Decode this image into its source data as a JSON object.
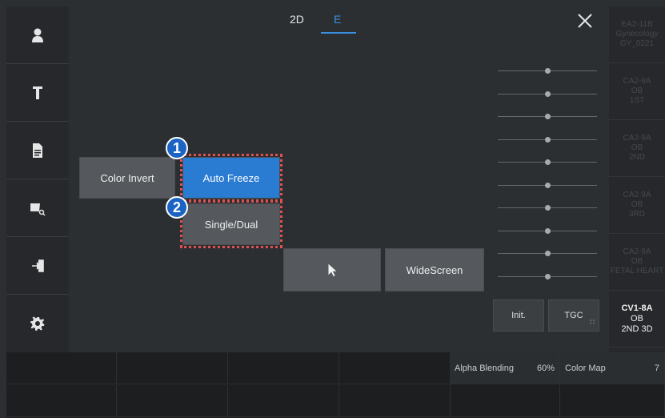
{
  "tabs": [
    {
      "label": "2D"
    },
    {
      "label": "E"
    }
  ],
  "buttons": {
    "color_invert": "Color Invert",
    "auto_freeze": "Auto Freeze",
    "single_dual": "Single/Dual",
    "widescreen": "WideScreen",
    "init": "Init.",
    "tgc": "TGC"
  },
  "callouts": [
    "1",
    "2"
  ],
  "sidebar_icons": [
    "user-icon",
    "probe-icon",
    "report-icon",
    "image-search-icon",
    "exit-icon",
    "settings-icon"
  ],
  "tgc_slider_levels": [
    0.5,
    0.5,
    0.5,
    0.5,
    0.5,
    0.5,
    0.5,
    0.5,
    0.5,
    0.5
  ],
  "presets": [
    {
      "line1": "EA2-11B",
      "line2": "Gynecology",
      "line3": "GY_0221"
    },
    {
      "line1": "CA2-9A",
      "line2": "OB",
      "line3": "1ST"
    },
    {
      "line1": "CA2-9A",
      "line2": "OB",
      "line3": "2ND"
    },
    {
      "line1": "CA2-9A",
      "line2": "OB",
      "line3": "3RD"
    },
    {
      "line1": "CA2-9A",
      "line2": "OB",
      "line3": "FETAL HEART"
    },
    {
      "line1": "CV1-8A",
      "line2": "OB",
      "line3": "2ND 3D"
    }
  ],
  "bottom_bar": {
    "alpha_blending": {
      "label": "Alpha Blending",
      "value": "60%"
    },
    "color_map": {
      "label": "Color Map",
      "value": "7"
    }
  },
  "colors": {
    "accent": "#2a7bd2",
    "highlight": "#e05050",
    "badge": "#1b64c4"
  }
}
